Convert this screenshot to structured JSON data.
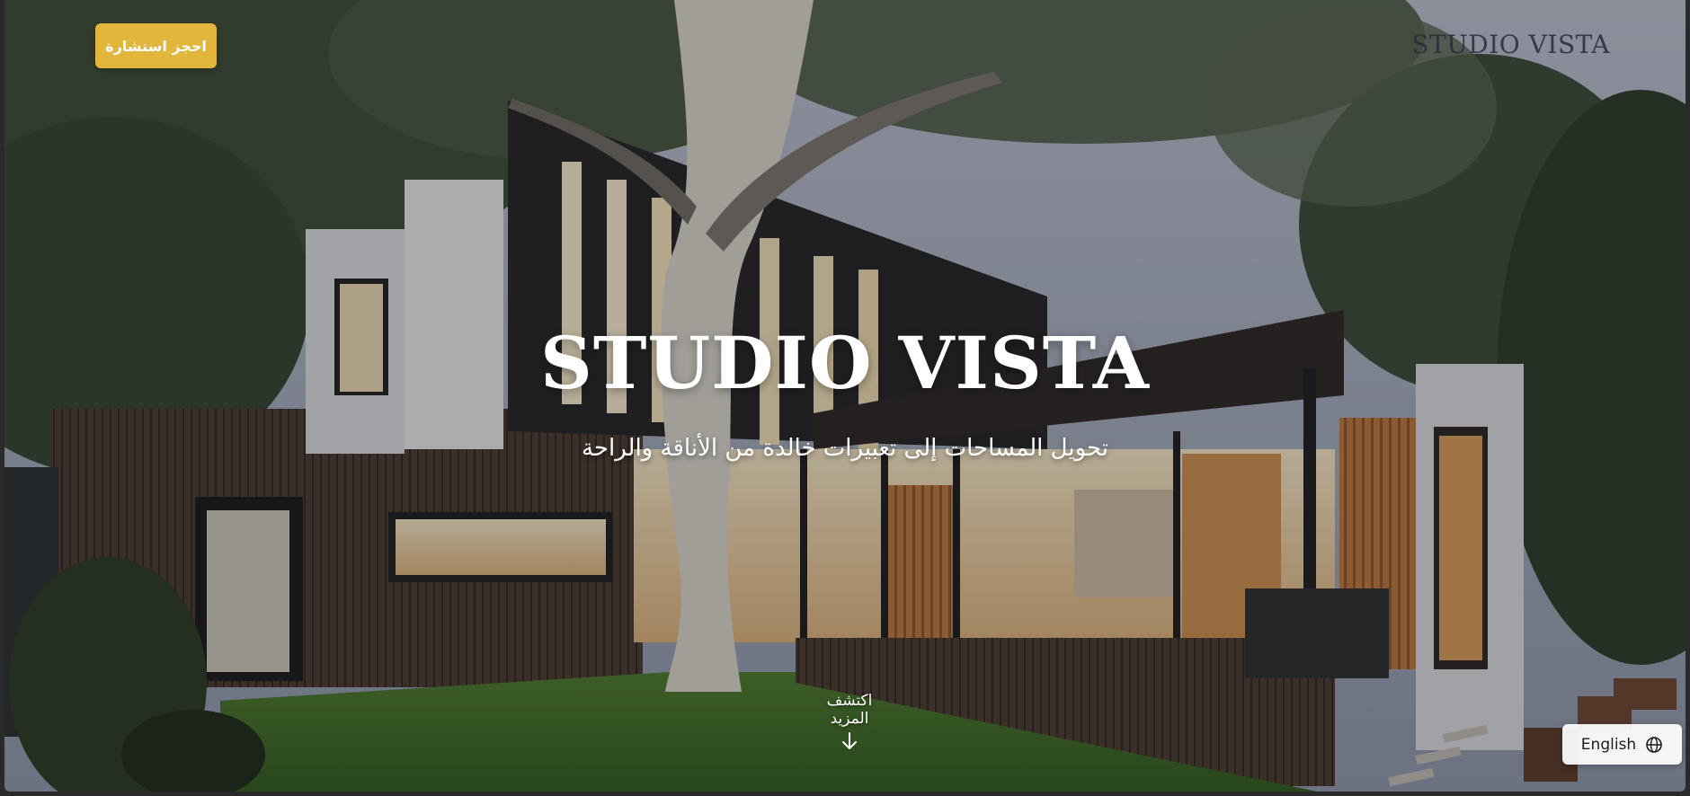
{
  "header": {
    "logo_text": "STUDIO VISTA",
    "book_button_label": "احجز استشارة"
  },
  "hero": {
    "title": "STUDIO VISTA",
    "subtitle": "تحويل المساحات إلى تعبيرات خالدة من الأناقة والراحة",
    "scroll_label": "اكتشف المزيد",
    "scroll_icon": "arrow-down-icon"
  },
  "language": {
    "label": "English",
    "icon": "globe-icon"
  },
  "colors": {
    "accent": "#e2b63a",
    "title": "#ffffff",
    "logo": "#282c3a"
  }
}
